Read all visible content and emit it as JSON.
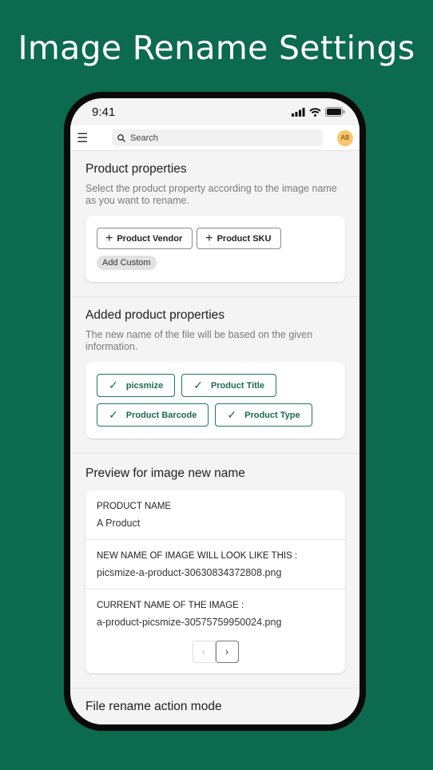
{
  "headline": "Image Rename Settings",
  "status": {
    "time": "9:41"
  },
  "topbar": {
    "search_placeholder": "Search",
    "avatar": "AB"
  },
  "product_properties": {
    "title": "Product properties",
    "description": "Select the product property according to the image name as you want to rename.",
    "buttons": [
      "Product Vendor",
      "Product SKU"
    ],
    "add_custom": "Add Custom"
  },
  "added_properties": {
    "title": "Added product properties",
    "description": "The new name of the file will be based on the given information.",
    "chips": [
      "picsmize",
      "Product Title",
      "Product Barcode",
      "Product Type"
    ]
  },
  "preview": {
    "title": "Preview for image new name",
    "rows": [
      {
        "label": "PRODUCT NAME",
        "value": "A Product"
      },
      {
        "label": "NEW NAME OF IMAGE WILL LOOK LIKE THIS :",
        "value": "picsmize-a-product-30630834372808.png"
      },
      {
        "label": "CURRENT NAME OF THE IMAGE :",
        "value": "a-product-picsmize-30575759950024.png"
      }
    ]
  },
  "next_section": {
    "title": "File rename action mode"
  },
  "colors": {
    "background": "#0c6a4e",
    "accent": "#1c7a5c",
    "avatar": "#f9c66b"
  }
}
